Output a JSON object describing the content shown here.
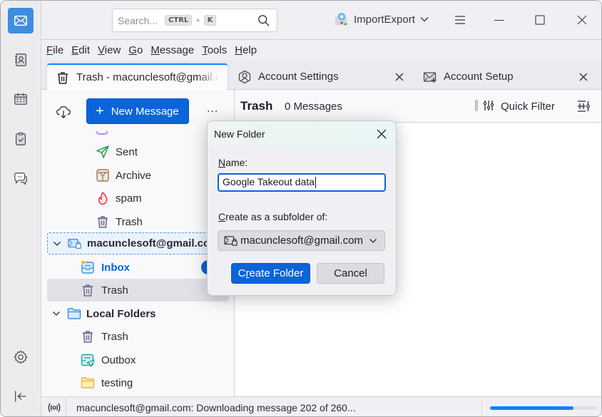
{
  "titlebar": {
    "search_placeholder": "Search...",
    "shortcut_key1": "CTRL",
    "shortcut_plus": "+",
    "shortcut_key2": "K",
    "addon_label": "ImportExport",
    "icons": [
      "search-icon",
      "addon-icon",
      "chevron-down-icon",
      "hamburger-menu-icon",
      "minimize-icon",
      "maximize-icon",
      "close-icon"
    ]
  },
  "spaces": {
    "items": [
      {
        "name": "mail",
        "icon": "mail-icon",
        "active": true
      },
      {
        "name": "address-book",
        "icon": "address-book-icon",
        "active": false
      },
      {
        "name": "calendar",
        "icon": "calendar-icon",
        "active": false
      },
      {
        "name": "tasks",
        "icon": "tasks-icon",
        "active": false
      },
      {
        "name": "chat",
        "icon": "chat-icon",
        "active": false
      }
    ],
    "settings_icon": "gear-icon",
    "collapse_icon": "collapse-left-icon"
  },
  "menubar": {
    "items": [
      {
        "accel": "F",
        "rest": "ile"
      },
      {
        "accel": "E",
        "rest": "dit"
      },
      {
        "accel": "V",
        "rest": "iew"
      },
      {
        "accel": "G",
        "rest": "o"
      },
      {
        "accel": "M",
        "rest": "essage"
      },
      {
        "accel": "T",
        "rest": "ools"
      },
      {
        "accel": "H",
        "rest": "elp"
      }
    ]
  },
  "tabs": [
    {
      "label": "Trash - macunclesoft@gmail.com",
      "icon": "trash-icon",
      "active": true
    },
    {
      "label": "Account Settings",
      "icon": "account-icon",
      "active": false
    },
    {
      "label": "Account Setup",
      "icon": "account-setup-icon",
      "active": false
    }
  ],
  "folderpane": {
    "new_message_label": "New Message",
    "more_label": "...",
    "folders": [
      {
        "label": "Sent",
        "icon": "sent-icon"
      },
      {
        "label": "Archive",
        "icon": "archive-icon"
      },
      {
        "label": "spam",
        "icon": "spam-icon"
      },
      {
        "label": "Trash",
        "icon": "trash-icon"
      }
    ],
    "account": {
      "label": "macunclesoft@gmail.com",
      "icon": "account-mail-icon",
      "folders": [
        {
          "label": "Inbox",
          "icon": "inbox-icon",
          "unread": "2"
        },
        {
          "label": "Trash",
          "icon": "trash-icon"
        }
      ]
    },
    "local": {
      "label": "Local Folders",
      "icon": "folder-icon",
      "folders": [
        {
          "label": "Trash",
          "icon": "trash-icon"
        },
        {
          "label": "Outbox",
          "icon": "outbox-icon"
        },
        {
          "label": "testing",
          "icon": "folder-icon"
        }
      ]
    }
  },
  "threadpane": {
    "title": "Trash",
    "count": "0 Messages",
    "quick_filter_label": "Quick Filter"
  },
  "statusbar": {
    "text": "macunclesoft@gmail.com: Downloading message 202 of 260...",
    "progress_fraction": 0.777
  },
  "dialog": {
    "title": "New Folder",
    "name_label_accel": "N",
    "name_label_rest": "ame:",
    "name_value": "Google Takeout data",
    "subfolder_label_accel": "C",
    "subfolder_label_rest": "reate as a subfolder of:",
    "subfolder_value": "macunclesoft@gmail.com",
    "create_label_a": "C",
    "create_label_accel": "r",
    "create_label_b": "eate Folder",
    "cancel_label": "Cancel"
  },
  "colors": {
    "accent": "#0b64d8",
    "progress": "#0a84ff",
    "active_space": "#3e8de0"
  }
}
